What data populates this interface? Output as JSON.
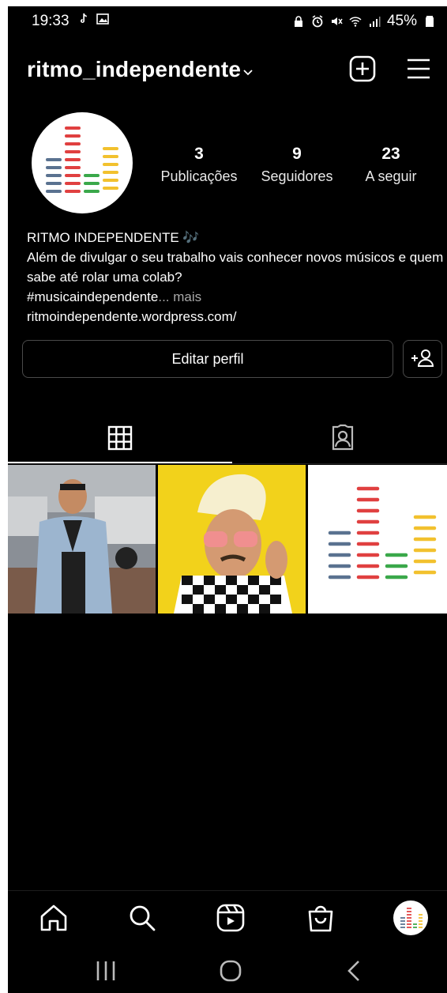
{
  "status_bar": {
    "time": "19:33",
    "battery": "45%",
    "icons_left": [
      "tiktok-icon",
      "gallery-icon"
    ],
    "icons_right": [
      "lock-icon",
      "alarm-icon",
      "mute-icon",
      "wifi-icon",
      "signal-icon",
      "battery-icon"
    ]
  },
  "header": {
    "username": "ritmo_independente",
    "icons": [
      "chevron-down-icon",
      "new-post-icon",
      "menu-icon"
    ]
  },
  "profile": {
    "stats": [
      {
        "value": "3",
        "label": "Publicações"
      },
      {
        "value": "9",
        "label": "Seguidores"
      },
      {
        "value": "23",
        "label": "A seguir"
      }
    ],
    "bio_name": "RITMO INDEPENDENTE",
    "bio_emoji": "🎶",
    "bio_text": "Além de divulgar o seu trabalho vais conhecer novos músicos e quem sabe até rolar uma colab?",
    "bio_hashtag": "#musicaindependente",
    "bio_more": "... mais",
    "link": "ritmoindependente.wordpress.com/",
    "edit_button": "Editar perfil",
    "add_person_icon": "add-person-icon"
  },
  "tabs": [
    {
      "icon": "grid-icon",
      "active": true
    },
    {
      "icon": "tagged-icon",
      "active": false
    }
  ],
  "posts": [
    {
      "kind": "photo",
      "subject": "man in denim shirt"
    },
    {
      "kind": "photo",
      "subject": "man with sunglasses on yellow background"
    },
    {
      "kind": "logo",
      "subject": "equalizer bars logo"
    }
  ],
  "bottom_nav": [
    "home-icon",
    "search-icon",
    "reels-icon",
    "shop-icon",
    "profile-avatar"
  ],
  "system_nav": [
    "recents-icon",
    "home-button-icon",
    "back-icon"
  ],
  "colors": {
    "background": "#000000",
    "text": "#ffffff",
    "muted": "#a8a8a8",
    "border": "#4a4a4a",
    "eq_red": "#e04040",
    "eq_blue": "#5a7290",
    "eq_green": "#3aa84a",
    "eq_yellow": "#f2c12e"
  }
}
